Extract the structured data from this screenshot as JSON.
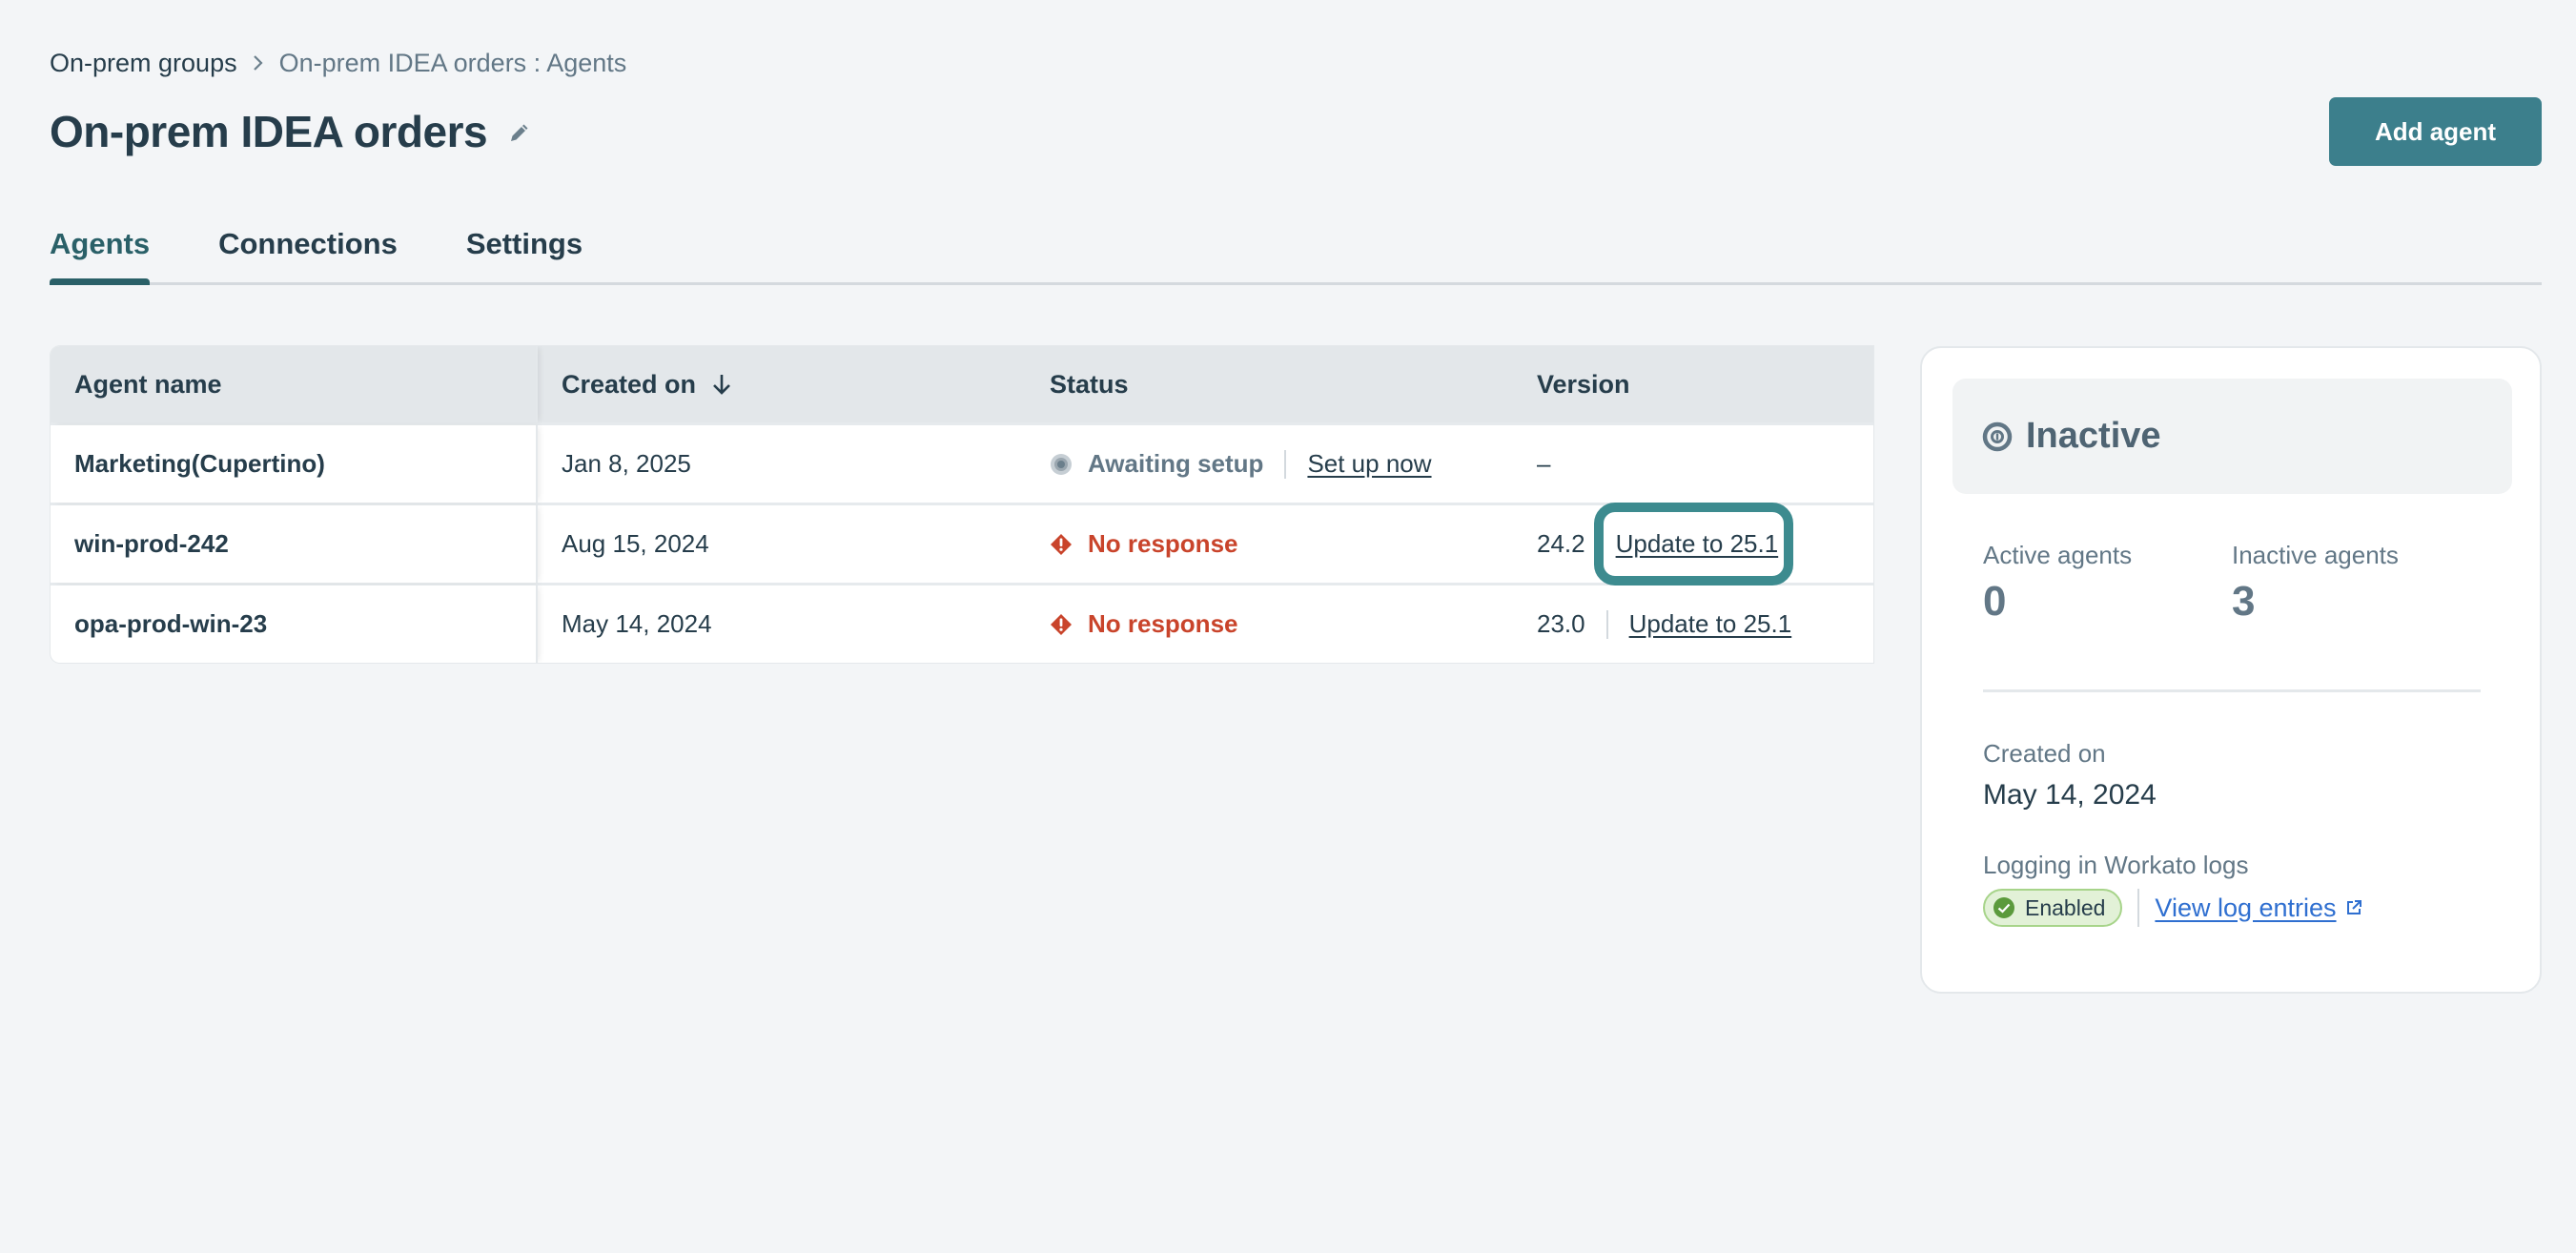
{
  "breadcrumb": {
    "parent": "On-prem groups",
    "separator_icon": "chevron-right-icon",
    "current": "On-prem IDEA orders : Agents"
  },
  "header": {
    "title": "On-prem IDEA orders",
    "edit_icon": "pencil-icon",
    "add_button": "Add agent"
  },
  "tabs": [
    {
      "label": "Agents",
      "active": true
    },
    {
      "label": "Connections",
      "active": false
    },
    {
      "label": "Settings",
      "active": false
    }
  ],
  "table": {
    "columns": [
      "Agent name",
      "Created on",
      "Status",
      "Version"
    ],
    "sort": {
      "column": "Created on",
      "direction": "descending",
      "icon": "arrow-down-icon"
    },
    "rows": [
      {
        "name": "Marketing(Cupertino)",
        "created": "Jan 8, 2025",
        "status": "Awaiting setup",
        "status_icon": "pending-dot-icon",
        "status_action": "Set up now",
        "version": "–",
        "version_action": ""
      },
      {
        "name": "win-prod-242",
        "created": "Aug 15, 2024",
        "status": "No response",
        "status_icon": "error-diamond-icon",
        "status_action": "",
        "version": "24.2",
        "version_action": "Update to 25.1",
        "focused": true
      },
      {
        "name": "opa-prod-win-23",
        "created": "May 14, 2024",
        "status": "No response",
        "status_icon": "error-diamond-icon",
        "status_action": "",
        "version": "23.0",
        "version_action": "Update to 25.1"
      }
    ]
  },
  "panel": {
    "status": "Inactive",
    "status_icon": "inactive-circle-icon",
    "active_label": "Active agents",
    "active_count": "0",
    "inactive_label": "Inactive agents",
    "inactive_count": "3",
    "created_label": "Created on",
    "created_value": "May 14, 2024",
    "logging_label": "Logging in Workato logs",
    "logging_badge": "Enabled",
    "logging_link": "View log entries",
    "link_icon": "external-link-icon"
  },
  "colors": {
    "accent": "#3c7f8c",
    "tab_active": "#2a6068",
    "error": "#c9442b",
    "focus_ring": "#3d8b8f",
    "link_blue": "#2f6fd0",
    "enabled_bg": "#e2f1d7"
  }
}
